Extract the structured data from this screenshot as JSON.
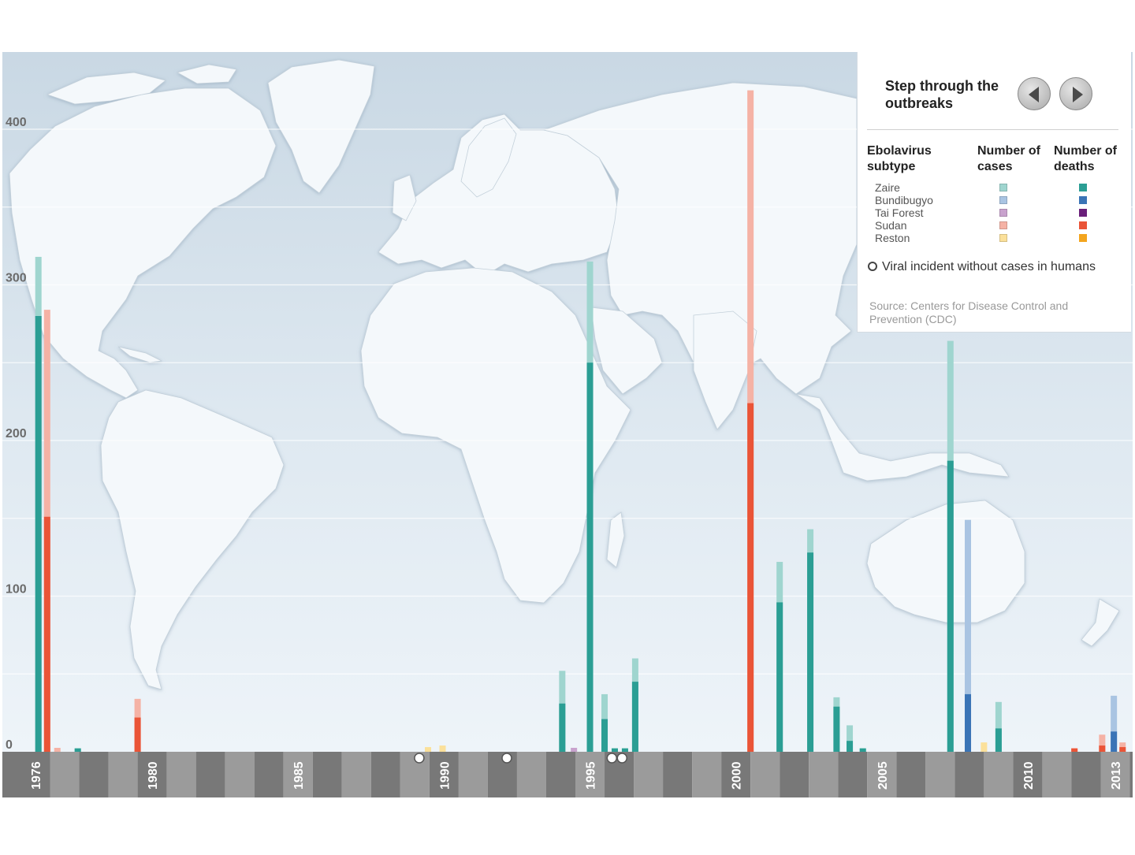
{
  "colors": {
    "zaire_cases": "#9fd5cf",
    "zaire_deaths": "#2b9e94",
    "bundibugyo_cases": "#a9c4e2",
    "bundibugyo_deaths": "#3a74b6",
    "tai_forest_cases": "#c8a2cd",
    "tai_forest_deaths": "#6a1f7a",
    "sudan_cases": "#f5b2a5",
    "sudan_deaths": "#ea5437",
    "reston_cases": "#fbe09a",
    "reston_deaths": "#f3a51e",
    "map_land": "#f4f8fb",
    "map_sea": "#d5e1ea",
    "timeline_dark": "#787878",
    "timeline_light": "#9b9b9b"
  },
  "legend": {
    "step_title": "Step through the outbreaks",
    "subtype_header": "Ebolavirus subtype",
    "cases_header": "Number of cases",
    "deaths_header": "Number of deaths",
    "subtypes": [
      {
        "key": "zaire",
        "label": "Zaire"
      },
      {
        "key": "bundibugyo",
        "label": "Bundibugyo"
      },
      {
        "key": "tai_forest",
        "label": "Tai Forest"
      },
      {
        "key": "sudan",
        "label": "Sudan"
      },
      {
        "key": "reston",
        "label": "Reston"
      }
    ],
    "viral_note": "Viral incident without cases in humans",
    "source": "Source: Centers for Disease Control and Prevention (CDC)"
  },
  "chart_data": {
    "type": "bar",
    "ylim": [
      0,
      420
    ],
    "y_ticks": [
      0,
      100,
      200,
      300,
      400
    ],
    "x_range": [
      1975.55,
      2013.95
    ],
    "x_tick_labels": [
      "1976",
      "1980",
      "1985",
      "1990",
      "1995",
      "2000",
      "2005",
      "2010",
      "2013"
    ],
    "x_tick_years": [
      1976,
      1980,
      1985,
      1990,
      1995,
      2000,
      2005,
      2010,
      2013
    ],
    "grid": true,
    "outbreaks": [
      {
        "x": 1976.1,
        "subtype": "zaire",
        "cases": 318,
        "deaths": 280
      },
      {
        "x": 1976.4,
        "subtype": "sudan",
        "cases": 284,
        "deaths": 151
      },
      {
        "x": 1976.75,
        "subtype": "sudan",
        "cases": 1,
        "deaths": 0
      },
      {
        "x": 1977.45,
        "subtype": "zaire",
        "cases": 1,
        "deaths": 1
      },
      {
        "x": 1979.5,
        "subtype": "sudan",
        "cases": 34,
        "deaths": 22
      },
      {
        "x": 1989.45,
        "subtype": "reston",
        "cases": 3,
        "deaths": 0
      },
      {
        "x": 1989.95,
        "subtype": "reston",
        "cases": 4,
        "deaths": 0
      },
      {
        "x": 1994.05,
        "subtype": "zaire",
        "cases": 52,
        "deaths": 31
      },
      {
        "x": 1994.45,
        "subtype": "tai_forest",
        "cases": 1,
        "deaths": 0
      },
      {
        "x": 1995.0,
        "subtype": "zaire",
        "cases": 315,
        "deaths": 250
      },
      {
        "x": 1995.5,
        "subtype": "zaire",
        "cases": 37,
        "deaths": 21
      },
      {
        "x": 1995.85,
        "subtype": "zaire",
        "cases": 1,
        "deaths": 1
      },
      {
        "x": 1996.2,
        "subtype": "zaire",
        "cases": 1,
        "deaths": 1
      },
      {
        "x": 1996.55,
        "subtype": "zaire",
        "cases": 60,
        "deaths": 45
      },
      {
        "x": 2000.5,
        "subtype": "sudan",
        "cases": 425,
        "deaths": 224
      },
      {
        "x": 2001.5,
        "subtype": "zaire",
        "cases": 122,
        "deaths": 96
      },
      {
        "x": 2002.55,
        "subtype": "zaire",
        "cases": 143,
        "deaths": 128
      },
      {
        "x": 2003.45,
        "subtype": "zaire",
        "cases": 35,
        "deaths": 29
      },
      {
        "x": 2003.9,
        "subtype": "zaire",
        "cases": 17,
        "deaths": 7
      },
      {
        "x": 2004.35,
        "subtype": "zaire",
        "cases": 2,
        "deaths": 2
      },
      {
        "x": 2007.35,
        "subtype": "zaire",
        "cases": 264,
        "deaths": 187
      },
      {
        "x": 2007.95,
        "subtype": "bundibugyo",
        "cases": 149,
        "deaths": 37
      },
      {
        "x": 2008.5,
        "subtype": "reston",
        "cases": 6,
        "deaths": 0
      },
      {
        "x": 2009.0,
        "subtype": "zaire",
        "cases": 32,
        "deaths": 15
      },
      {
        "x": 2011.6,
        "subtype": "sudan",
        "cases": 1,
        "deaths": 1
      },
      {
        "x": 2012.55,
        "subtype": "sudan",
        "cases": 11,
        "deaths": 4
      },
      {
        "x": 2012.95,
        "subtype": "bundibugyo",
        "cases": 36,
        "deaths": 13
      },
      {
        "x": 2013.25,
        "subtype": "sudan",
        "cases": 6,
        "deaths": 3
      }
    ],
    "viral_incidents": [
      1989.15,
      1992.15,
      1995.75,
      1996.1
    ]
  }
}
